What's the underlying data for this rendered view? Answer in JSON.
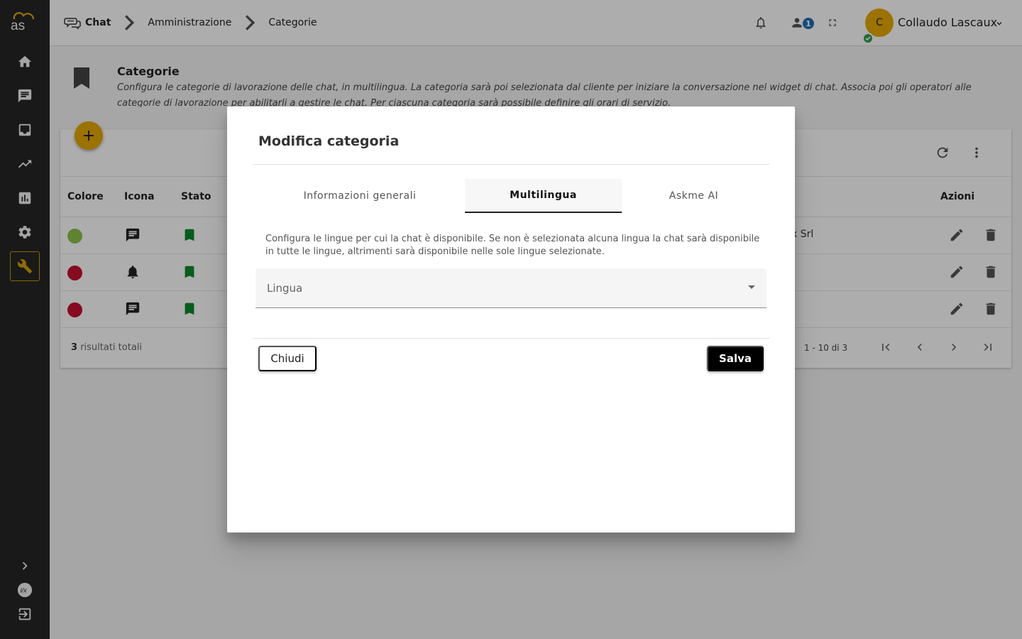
{
  "header": {
    "breadcrumb": [
      "Chat",
      "Amministrazione",
      "Categorie"
    ],
    "notification_count": "1",
    "user": {
      "initial": "C",
      "name": "Collaudo Lascaux"
    }
  },
  "sidebar": {
    "items": [
      "home",
      "chat",
      "inbox",
      "trend",
      "stats",
      "settings",
      "admin-tools"
    ],
    "active": "admin-tools"
  },
  "page": {
    "title": "Categorie",
    "description": "Configura le categorie di lavorazione delle chat, in multilingua. La categoria sarà poi selezionata dal cliente per iniziare la conversazione nel widget di chat. Associa poi gli operatori alle categorie di lavorazione per abilitarli a gestire le chat. Per ciascuna categoria sarà possibile definire gli orari di servizio."
  },
  "table": {
    "columns": {
      "color": "Colore",
      "icon": "Icona",
      "status": "Stato",
      "actions": "Azioni"
    },
    "rows": [
      {
        "color": "#8bc34a",
        "icon": "chat-icon",
        "status": "active",
        "extra": "x Srl"
      },
      {
        "color": "#c8102e",
        "icon": "bell-icon",
        "status": "active",
        "extra": ""
      },
      {
        "color": "#c8102e",
        "icon": "chat-icon",
        "status": "active",
        "extra": ""
      }
    ],
    "total_count": "3",
    "total_label": "risultati totali",
    "pagination": "1 - 10 di 3"
  },
  "modal": {
    "title": "Modifica categoria",
    "tabs": [
      {
        "label": "Informazioni generali",
        "active": false
      },
      {
        "label": "Multilingua",
        "active": true
      },
      {
        "label": "Askme AI",
        "active": false
      }
    ],
    "description": "Configura le lingue per cui la chat è disponibile. Se non è selezionata alcuna lingua la chat sarà disponibile in tutte le lingue, altrimenti sarà disponibile nelle sole lingue selezionate.",
    "select_label": "Lingua",
    "close_label": "Chiudi",
    "save_label": "Salva"
  },
  "colors": {
    "accent": "#e6a900",
    "status_green": "#0a8a2a",
    "badge_blue": "#1f6fb5"
  }
}
